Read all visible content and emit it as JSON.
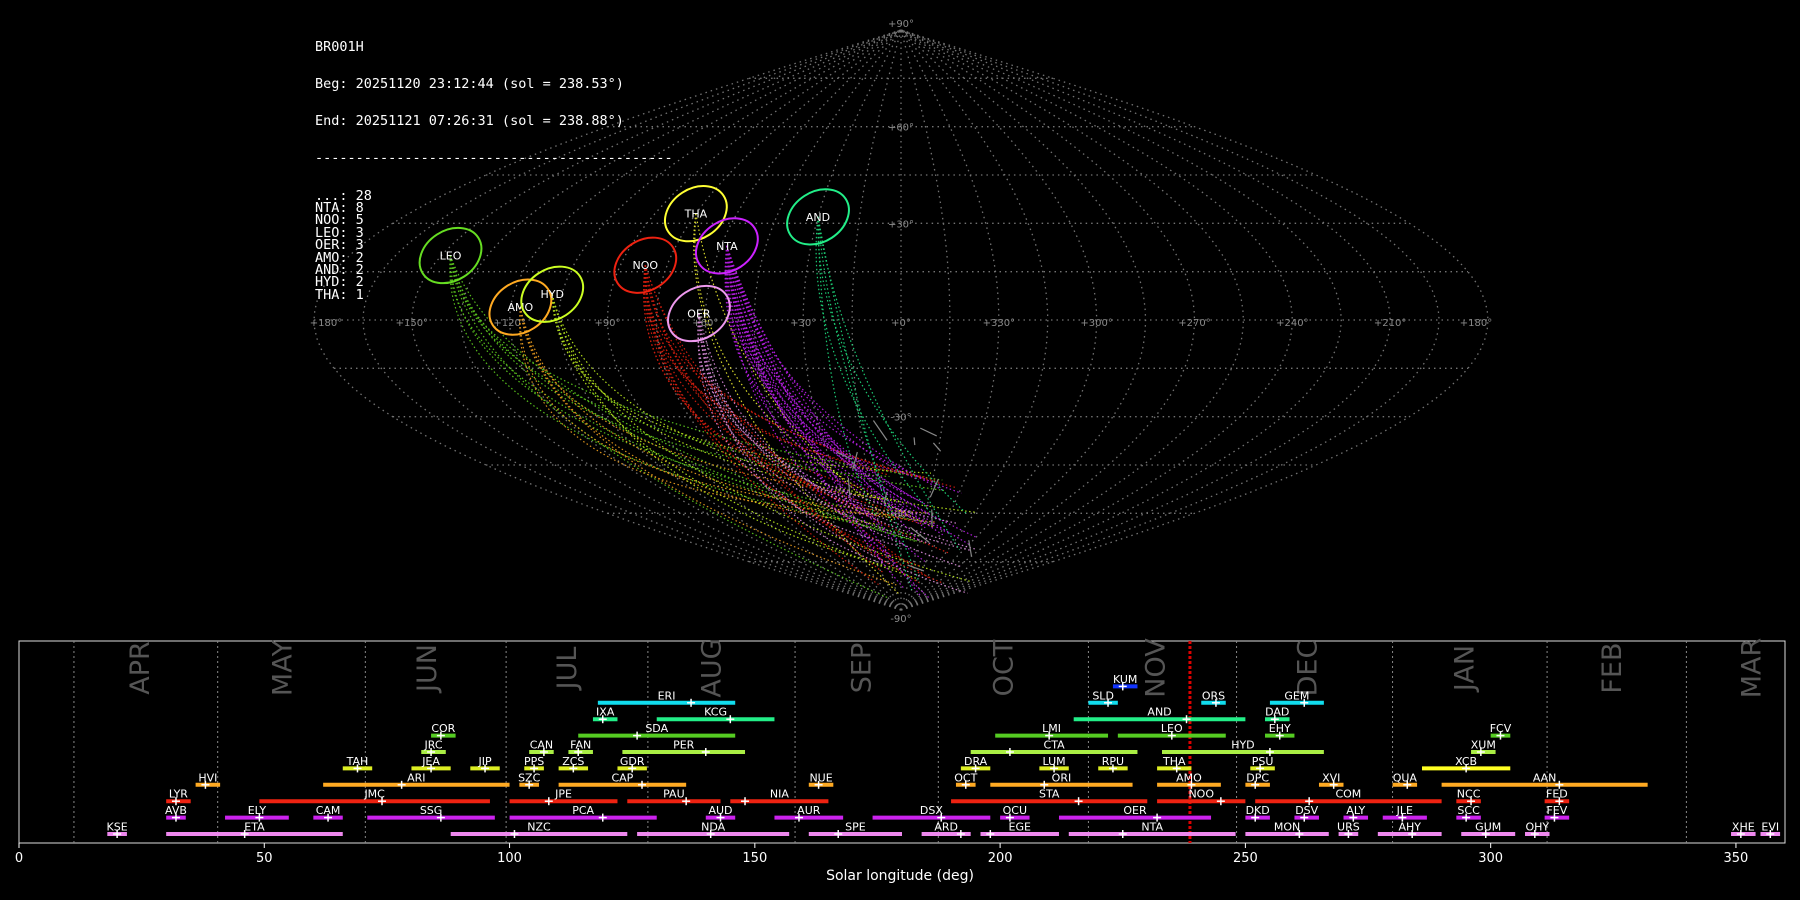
{
  "header": {
    "station": "BR001H",
    "begin": "Beg: 20251120 23:12:44 (sol = 238.53°)",
    "end": "End: 20251121 07:26:31 (sol = 238.88°)",
    "separator": "--------------------------------------------",
    "counts": [
      {
        "code": "...",
        "count": 28
      },
      {
        "code": "NTA",
        "count": 8
      },
      {
        "code": "NOO",
        "count": 5
      },
      {
        "code": "LEO",
        "count": 3
      },
      {
        "code": "OER",
        "count": 3
      },
      {
        "code": "AMO",
        "count": 2
      },
      {
        "code": "AND",
        "count": 2
      },
      {
        "code": "HYD",
        "count": 2
      },
      {
        "code": "THA",
        "count": 1
      }
    ]
  },
  "chart_data": [
    {
      "type": "scatter",
      "projection": "sinusoidal",
      "lon_labels": [
        "+180°",
        "+150°",
        "+120°",
        "+90°",
        "+60°",
        "+30°",
        "+0°",
        "+330°",
        "+300°",
        "+270°",
        "+240°",
        "+210°",
        "+180°"
      ],
      "lat_labels": [
        "+90°",
        "+60°",
        "+30°",
        "-30°",
        "-60°",
        "-90°"
      ],
      "radiants": [
        {
          "code": "LEO",
          "lon": 147,
          "lat": 20,
          "color": "#66dd22",
          "count": 3
        },
        {
          "code": "AMO",
          "lon": 117,
          "lat": 4,
          "color": "#ffaa22",
          "count": 2
        },
        {
          "code": "HYD",
          "lon": 108,
          "lat": 8,
          "color": "#ccff22",
          "count": 2
        },
        {
          "code": "THA",
          "lon": 75,
          "lat": 33,
          "color": "#ffff33",
          "count": 1
        },
        {
          "code": "NOO",
          "lon": 82,
          "lat": 17,
          "color": "#ee2211",
          "count": 5
        },
        {
          "code": "NTA",
          "lon": 58,
          "lat": 23,
          "color": "#cc22ff",
          "count": 8
        },
        {
          "code": "OER",
          "lon": 62,
          "lat": 2,
          "color": "#ee99ee",
          "count": 3
        },
        {
          "code": "AND",
          "lon": 30,
          "lat": 32,
          "color": "#22ee88",
          "count": 2
        }
      ]
    },
    {
      "type": "bar",
      "xlabel": "Solar longitude (deg)",
      "xlim": [
        0,
        360
      ],
      "xticks": [
        0,
        50,
        100,
        150,
        200,
        250,
        300,
        350
      ],
      "current_sol": 238.7,
      "months": [
        {
          "name": "APR",
          "start": 11.2,
          "center": 25
        },
        {
          "name": "MAY",
          "start": 40.5,
          "center": 54
        },
        {
          "name": "JUN",
          "start": 70.6,
          "center": 83.5
        },
        {
          "name": "JUL",
          "start": 99.3,
          "center": 112
        },
        {
          "name": "AUG",
          "start": 128.2,
          "center": 141.5
        },
        {
          "name": "SEP",
          "start": 158.2,
          "center": 172
        },
        {
          "name": "OCT",
          "start": 187.4,
          "center": 201
        },
        {
          "name": "NOV",
          "start": 218.0,
          "center": 232
        },
        {
          "name": "DEC",
          "start": 248.2,
          "center": 263
        },
        {
          "name": "JAN",
          "start": 280.0,
          "center": 295
        },
        {
          "name": "FEB",
          "start": 311.5,
          "center": 325
        },
        {
          "name": "MAR",
          "start": 339.9,
          "center": 353.5
        }
      ],
      "showers": [
        {
          "code": "KUM",
          "start": 223,
          "end": 228,
          "peak": 225,
          "row": 9,
          "color": "#1133ff"
        },
        {
          "code": "ERI",
          "start": 118,
          "end": 146,
          "peak": 137,
          "row": 8,
          "color": "#11ddee"
        },
        {
          "code": "SLD",
          "start": 218,
          "end": 224,
          "peak": 222,
          "row": 8,
          "color": "#11ddee"
        },
        {
          "code": "ORS",
          "start": 241,
          "end": 246,
          "peak": 244,
          "row": 8,
          "color": "#11ddee"
        },
        {
          "code": "GEM",
          "start": 255,
          "end": 266,
          "peak": 262,
          "row": 8,
          "color": "#11ddee"
        },
        {
          "code": "IXA",
          "start": 117,
          "end": 122,
          "peak": 119,
          "row": 7,
          "color": "#22ee88"
        },
        {
          "code": "KCG",
          "start": 130,
          "end": 154,
          "peak": 145,
          "row": 7,
          "color": "#22ee88"
        },
        {
          "code": "AND",
          "start": 215,
          "end": 250,
          "peak": 238,
          "row": 7,
          "color": "#22ee88"
        },
        {
          "code": "DAD",
          "start": 254,
          "end": 259,
          "peak": 256,
          "row": 7,
          "color": "#22ee88"
        },
        {
          "code": "COR",
          "start": 84,
          "end": 89,
          "peak": 86,
          "row": 6,
          "color": "#55cc22"
        },
        {
          "code": "SDA",
          "start": 114,
          "end": 146,
          "peak": 126,
          "row": 6,
          "color": "#55cc22"
        },
        {
          "code": "LMI",
          "start": 199,
          "end": 222,
          "peak": 210,
          "row": 6,
          "color": "#55cc22"
        },
        {
          "code": "LEO",
          "start": 224,
          "end": 246,
          "peak": 235,
          "row": 6,
          "color": "#55cc22"
        },
        {
          "code": "EHY",
          "start": 254,
          "end": 260,
          "peak": 257,
          "row": 6,
          "color": "#55cc22"
        },
        {
          "code": "FCV",
          "start": 300,
          "end": 304,
          "peak": 302,
          "row": 6,
          "color": "#55cc22"
        },
        {
          "code": "JRC",
          "start": 82,
          "end": 87,
          "peak": 84,
          "row": 5,
          "color": "#aaee44"
        },
        {
          "code": "CAN",
          "start": 104,
          "end": 109,
          "peak": 107,
          "row": 5,
          "color": "#aaee44"
        },
        {
          "code": "FAN",
          "start": 112,
          "end": 117,
          "peak": 114,
          "row": 5,
          "color": "#aaee44"
        },
        {
          "code": "PER",
          "start": 123,
          "end": 148,
          "peak": 140,
          "row": 5,
          "color": "#aaee44"
        },
        {
          "code": "CTA",
          "start": 194,
          "end": 228,
          "peak": 202,
          "row": 5,
          "color": "#aaee44"
        },
        {
          "code": "HYD",
          "start": 233,
          "end": 266,
          "peak": 255,
          "row": 5,
          "color": "#aaee44"
        },
        {
          "code": "XUM",
          "start": 296,
          "end": 301,
          "peak": 298,
          "row": 5,
          "color": "#aaee44"
        },
        {
          "code": "TAH",
          "start": 66,
          "end": 72,
          "peak": 69,
          "row": 4,
          "color": "#ddee22"
        },
        {
          "code": "JEA",
          "start": 80,
          "end": 88,
          "peak": 84,
          "row": 4,
          "color": "#ddee22"
        },
        {
          "code": "JIP",
          "start": 92,
          "end": 98,
          "peak": 95,
          "row": 4,
          "color": "#ddee22"
        },
        {
          "code": "PPS",
          "start": 103,
          "end": 107,
          "peak": 105,
          "row": 4,
          "color": "#ddee22"
        },
        {
          "code": "ZCS",
          "start": 110,
          "end": 116,
          "peak": 113,
          "row": 4,
          "color": "#ddee22"
        },
        {
          "code": "GDR",
          "start": 122,
          "end": 128,
          "peak": 125,
          "row": 4,
          "color": "#ddee22"
        },
        {
          "code": "DRA",
          "start": 192,
          "end": 198,
          "peak": 195,
          "row": 4,
          "color": "#ddee22"
        },
        {
          "code": "LUM",
          "start": 208,
          "end": 214,
          "peak": 211,
          "row": 4,
          "color": "#ddee22"
        },
        {
          "code": "RPU",
          "start": 220,
          "end": 226,
          "peak": 223,
          "row": 4,
          "color": "#ddee22"
        },
        {
          "code": "THA",
          "start": 232,
          "end": 239,
          "peak": 236,
          "row": 4,
          "color": "#ddee22"
        },
        {
          "code": "PSU",
          "start": 251,
          "end": 256,
          "peak": 253,
          "row": 4,
          "color": "#ddee22"
        },
        {
          "code": "XCB",
          "start": 286,
          "end": 304,
          "peak": 295,
          "row": 4,
          "color": "#ffff22"
        },
        {
          "code": "HVI",
          "start": 36,
          "end": 41,
          "peak": 38,
          "row": 3,
          "color": "#ffaa22"
        },
        {
          "code": "ARI",
          "start": 62,
          "end": 100,
          "peak": 78,
          "row": 3,
          "color": "#ffaa22"
        },
        {
          "code": "SZC",
          "start": 102,
          "end": 106,
          "peak": 104,
          "row": 3,
          "color": "#ffaa22"
        },
        {
          "code": "CAP",
          "start": 110,
          "end": 136,
          "peak": 127,
          "row": 3,
          "color": "#ffaa22"
        },
        {
          "code": "NUE",
          "start": 161,
          "end": 166,
          "peak": 163,
          "row": 3,
          "color": "#ffaa22"
        },
        {
          "code": "OCT",
          "start": 191,
          "end": 195,
          "peak": 193,
          "row": 3,
          "color": "#ffaa22"
        },
        {
          "code": "ORI",
          "start": 198,
          "end": 227,
          "peak": 209,
          "row": 3,
          "color": "#ffaa22"
        },
        {
          "code": "AMO",
          "start": 232,
          "end": 245,
          "peak": 239,
          "row": 3,
          "color": "#ffaa22"
        },
        {
          "code": "DPC",
          "start": 250,
          "end": 255,
          "peak": 252,
          "row": 3,
          "color": "#ffaa22"
        },
        {
          "code": "XVI",
          "start": 265,
          "end": 270,
          "peak": 268,
          "row": 3,
          "color": "#ffaa22"
        },
        {
          "code": "QUA",
          "start": 280,
          "end": 285,
          "peak": 283,
          "row": 3,
          "color": "#ffaa22"
        },
        {
          "code": "AAN",
          "start": 290,
          "end": 332,
          "peak": 314,
          "row": 3,
          "color": "#ffaa22"
        },
        {
          "code": "LYR",
          "start": 30,
          "end": 35,
          "peak": 32,
          "row": 2,
          "color": "#ee2211"
        },
        {
          "code": "JMC",
          "start": 49,
          "end": 96,
          "peak": 74,
          "row": 2,
          "color": "#ee2211"
        },
        {
          "code": "JPE",
          "start": 100,
          "end": 122,
          "peak": 108,
          "row": 2,
          "color": "#ee2211"
        },
        {
          "code": "PAU",
          "start": 124,
          "end": 143,
          "peak": 136,
          "row": 2,
          "color": "#ee2211"
        },
        {
          "code": "NIA",
          "start": 145,
          "end": 165,
          "peak": 148,
          "row": 2,
          "color": "#ee2211"
        },
        {
          "code": "STA",
          "start": 190,
          "end": 230,
          "peak": 216,
          "row": 2,
          "color": "#ee2211"
        },
        {
          "code": "NOO",
          "start": 232,
          "end": 250,
          "peak": 245,
          "row": 2,
          "color": "#ee2211"
        },
        {
          "code": "COM",
          "start": 252,
          "end": 290,
          "peak": 263,
          "row": 2,
          "color": "#ee2211"
        },
        {
          "code": "NCC",
          "start": 293,
          "end": 298,
          "peak": 296,
          "row": 2,
          "color": "#ee2211"
        },
        {
          "code": "FED",
          "start": 311,
          "end": 316,
          "peak": 314,
          "row": 2,
          "color": "#ee2211"
        },
        {
          "code": "AVB",
          "start": 30,
          "end": 34,
          "peak": 32,
          "row": 1,
          "color": "#cc22ee"
        },
        {
          "code": "ELY",
          "start": 42,
          "end": 55,
          "peak": 49,
          "row": 1,
          "color": "#cc22ee"
        },
        {
          "code": "CAM",
          "start": 60,
          "end": 66,
          "peak": 63,
          "row": 1,
          "color": "#cc22ee"
        },
        {
          "code": "SSG",
          "start": 71,
          "end": 97,
          "peak": 86,
          "row": 1,
          "color": "#cc22ee"
        },
        {
          "code": "PCA",
          "start": 100,
          "end": 130,
          "peak": 119,
          "row": 1,
          "color": "#cc22ee"
        },
        {
          "code": "AUD",
          "start": 140,
          "end": 146,
          "peak": 143,
          "row": 1,
          "color": "#cc22ee"
        },
        {
          "code": "AUR",
          "start": 154,
          "end": 168,
          "peak": 159,
          "row": 1,
          "color": "#cc22ee"
        },
        {
          "code": "DSX",
          "start": 174,
          "end": 198,
          "peak": 188,
          "row": 1,
          "color": "#cc22ee"
        },
        {
          "code": "OCU",
          "start": 200,
          "end": 206,
          "peak": 202,
          "row": 1,
          "color": "#cc22ee"
        },
        {
          "code": "OER",
          "start": 212,
          "end": 243,
          "peak": 232,
          "row": 1,
          "color": "#cc22ee"
        },
        {
          "code": "DKD",
          "start": 250,
          "end": 255,
          "peak": 252,
          "row": 1,
          "color": "#cc22ee"
        },
        {
          "code": "DSV",
          "start": 260,
          "end": 265,
          "peak": 262,
          "row": 1,
          "color": "#cc22ee"
        },
        {
          "code": "ALY",
          "start": 270,
          "end": 275,
          "peak": 272,
          "row": 1,
          "color": "#cc22ee"
        },
        {
          "code": "JLE",
          "start": 278,
          "end": 287,
          "peak": 282,
          "row": 1,
          "color": "#cc22ee"
        },
        {
          "code": "SCC",
          "start": 293,
          "end": 298,
          "peak": 295,
          "row": 1,
          "color": "#cc22ee"
        },
        {
          "code": "FEV",
          "start": 311,
          "end": 316,
          "peak": 313,
          "row": 1,
          "color": "#cc22ee"
        },
        {
          "code": "KSE",
          "start": 18,
          "end": 22,
          "peak": 20,
          "row": 0,
          "color": "#ee88ee"
        },
        {
          "code": "ETA",
          "start": 30,
          "end": 66,
          "peak": 46,
          "row": 0,
          "color": "#ee88ee"
        },
        {
          "code": "NZC",
          "start": 88,
          "end": 124,
          "peak": 101,
          "row": 0,
          "color": "#ee88ee"
        },
        {
          "code": "NDA",
          "start": 126,
          "end": 157,
          "peak": 141,
          "row": 0,
          "color": "#ee88ee"
        },
        {
          "code": "SPE",
          "start": 161,
          "end": 180,
          "peak": 167,
          "row": 0,
          "color": "#ee88ee"
        },
        {
          "code": "ARD",
          "start": 184,
          "end": 194,
          "peak": 192,
          "row": 0,
          "color": "#ee88ee"
        },
        {
          "code": "EGE",
          "start": 196,
          "end": 212,
          "peak": 198,
          "row": 0,
          "color": "#ee88ee"
        },
        {
          "code": "NTA",
          "start": 214,
          "end": 248,
          "peak": 225,
          "row": 0,
          "color": "#ee88ee"
        },
        {
          "code": "MON",
          "start": 250,
          "end": 267,
          "peak": 261,
          "row": 0,
          "color": "#ee88ee"
        },
        {
          "code": "URS",
          "start": 269,
          "end": 273,
          "peak": 271,
          "row": 0,
          "color": "#ee88ee"
        },
        {
          "code": "AHY",
          "start": 277,
          "end": 290,
          "peak": 284,
          "row": 0,
          "color": "#ee88ee"
        },
        {
          "code": "GUM",
          "start": 294,
          "end": 305,
          "peak": 299,
          "row": 0,
          "color": "#ee88ee"
        },
        {
          "code": "OHY",
          "start": 307,
          "end": 312,
          "peak": 309,
          "row": 0,
          "color": "#ee88ee"
        },
        {
          "code": "XHE",
          "start": 349,
          "end": 354,
          "peak": 351,
          "row": 0,
          "color": "#ee88ee"
        },
        {
          "code": "EVI",
          "start": 355,
          "end": 359,
          "peak": 357,
          "row": 0,
          "color": "#ee88ee"
        }
      ]
    }
  ]
}
